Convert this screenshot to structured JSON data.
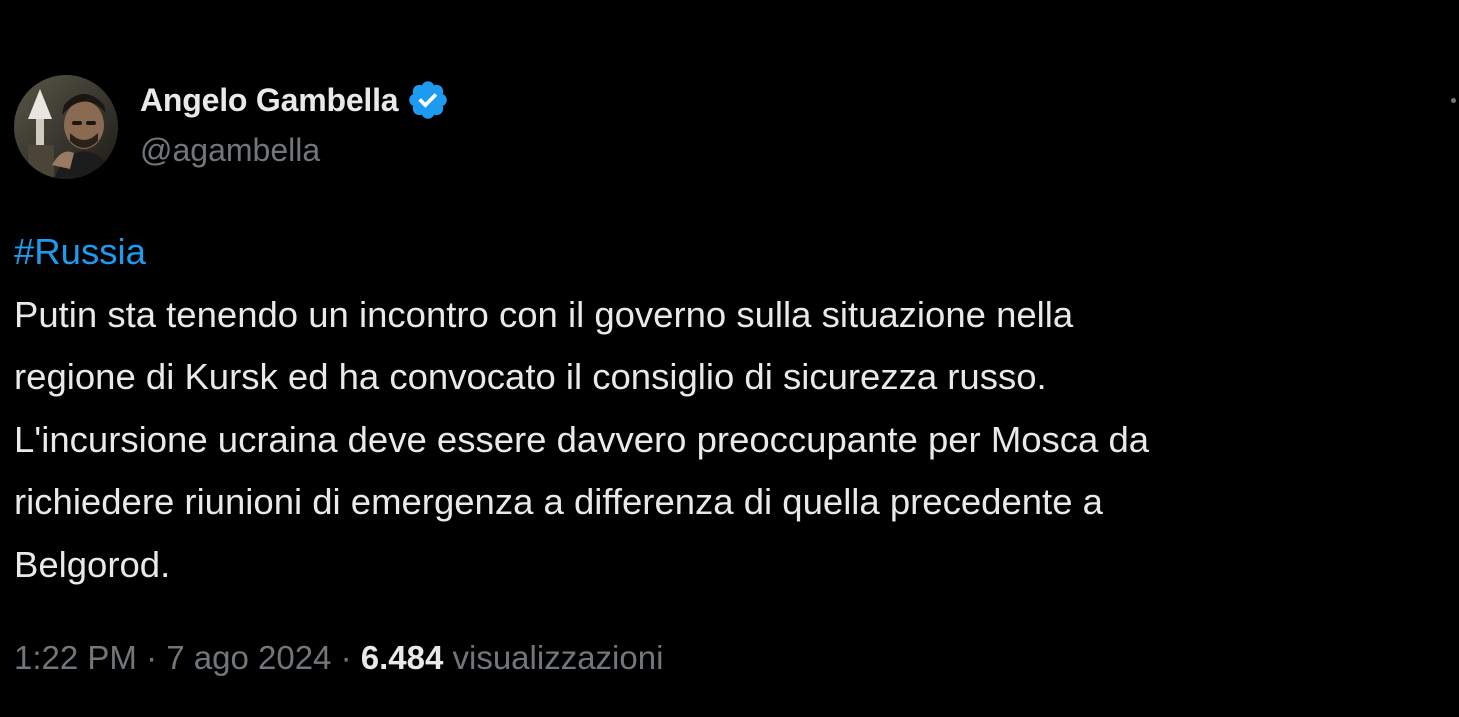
{
  "author": {
    "name": "Angelo Gambella",
    "handle": "@agambella",
    "verified": true,
    "verified_color": "#1d9bf0"
  },
  "tweet": {
    "hashtag": "#Russia",
    "lines": [
      "Putin sta tenendo un incontro con il governo sulla situazione nella",
      "regione di Kursk ed ha convocato il consiglio di sicurezza russo.",
      "L'incursione ucraina deve essere davvero preoccupante per Mosca da",
      "richiedere riunioni di emergenza a differenza di quella precedente a",
      "Belgorod."
    ]
  },
  "meta": {
    "time": "1:22 PM",
    "separator": " · ",
    "date": "7 ago 2024",
    "views_count": "6.484",
    "views_label": "visualizzazioni"
  },
  "icons": {
    "verified": "verified-badge-icon",
    "more": "more-options-icon"
  },
  "colors": {
    "background": "#000000",
    "text_primary": "#e7e9ea",
    "text_secondary": "#71767b",
    "link": "#1d9bf0"
  }
}
